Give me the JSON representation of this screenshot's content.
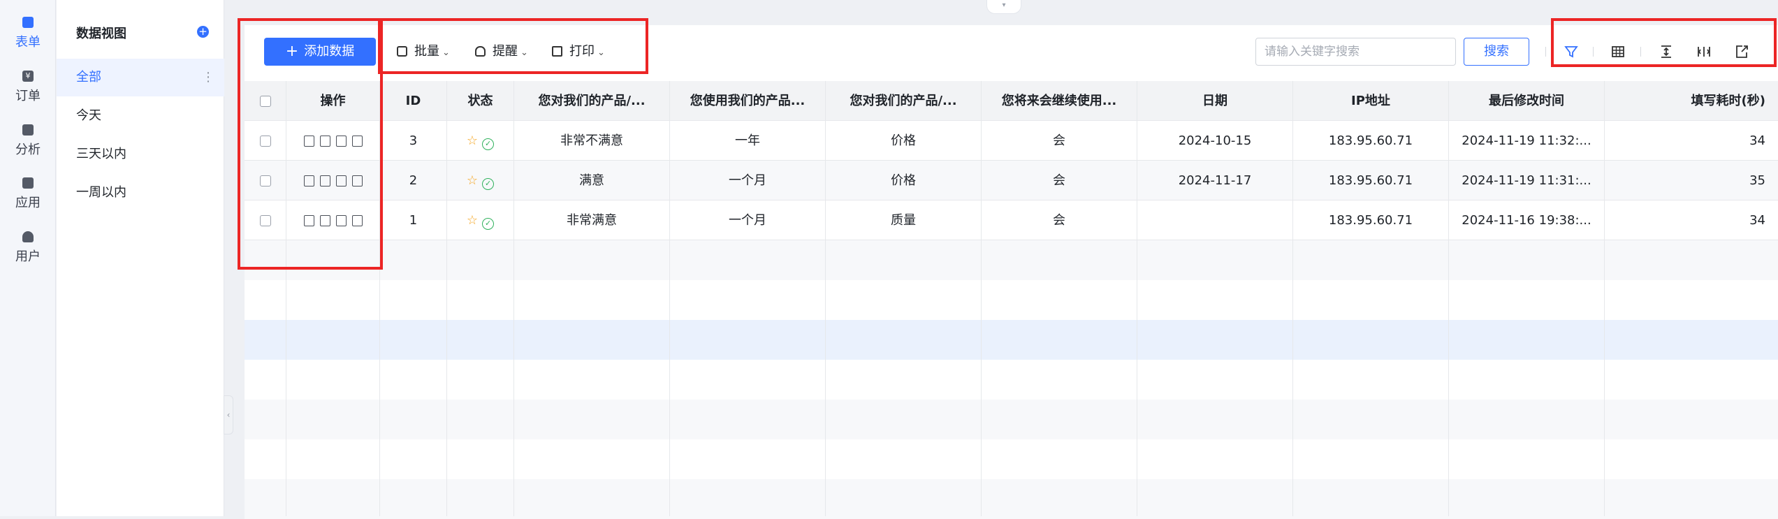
{
  "rail": {
    "items": [
      {
        "label": "表单",
        "icon": "form-icon"
      },
      {
        "label": "订单",
        "icon": "order-yen-icon"
      },
      {
        "label": "分析",
        "icon": "chart-icon"
      },
      {
        "label": "应用",
        "icon": "app-grid-icon"
      },
      {
        "label": "用户",
        "icon": "user-icon"
      }
    ]
  },
  "sidebar": {
    "title": "数据视图",
    "add_icon": "plus-circle-icon",
    "items": [
      {
        "label": "全部"
      },
      {
        "label": "今天"
      },
      {
        "label": "三天以内"
      },
      {
        "label": "一周以内"
      }
    ]
  },
  "toolbar": {
    "add_label": "添加数据",
    "batch_label": "批量",
    "remind_label": "提醒",
    "print_label": "打印",
    "search_placeholder": "请输入关键字搜索",
    "search_label": "搜索",
    "right_icons": [
      "filter-icon",
      "table-icon",
      "row-height-icon",
      "column-width-icon",
      "export-icon"
    ]
  },
  "table": {
    "headers": [
      "操作",
      "ID",
      "状态",
      "您对我们的产品/...",
      "您使用我们的产品...",
      "您对我们的产品/...",
      "您将来会继续使用...",
      "日期",
      "IP地址",
      "最后修改时间",
      "填写耗时(秒)"
    ],
    "rows": [
      {
        "id": "3",
        "q1": "非常不满意",
        "q2": "一年",
        "q3": "价格",
        "q4": "会",
        "date": "2024-10-15",
        "ip": "183.95.60.71",
        "modified": "2024-11-19 11:32:...",
        "duration": "34"
      },
      {
        "id": "2",
        "q1": "满意",
        "q2": "一个月",
        "q3": "价格",
        "q4": "会",
        "date": "2024-11-17",
        "ip": "183.95.60.71",
        "modified": "2024-11-19 11:31:...",
        "duration": "35"
      },
      {
        "id": "1",
        "q1": "非常满意",
        "q2": "一个月",
        "q3": "质量",
        "q4": "会",
        "date": "",
        "ip": "183.95.60.71",
        "modified": "2024-11-16 19:38:...",
        "duration": "34"
      }
    ]
  },
  "colors": {
    "accent": "#3370ff",
    "highlight_box": "#ec2525",
    "status_ok": "#2fb15c",
    "star": "#f5a623"
  }
}
